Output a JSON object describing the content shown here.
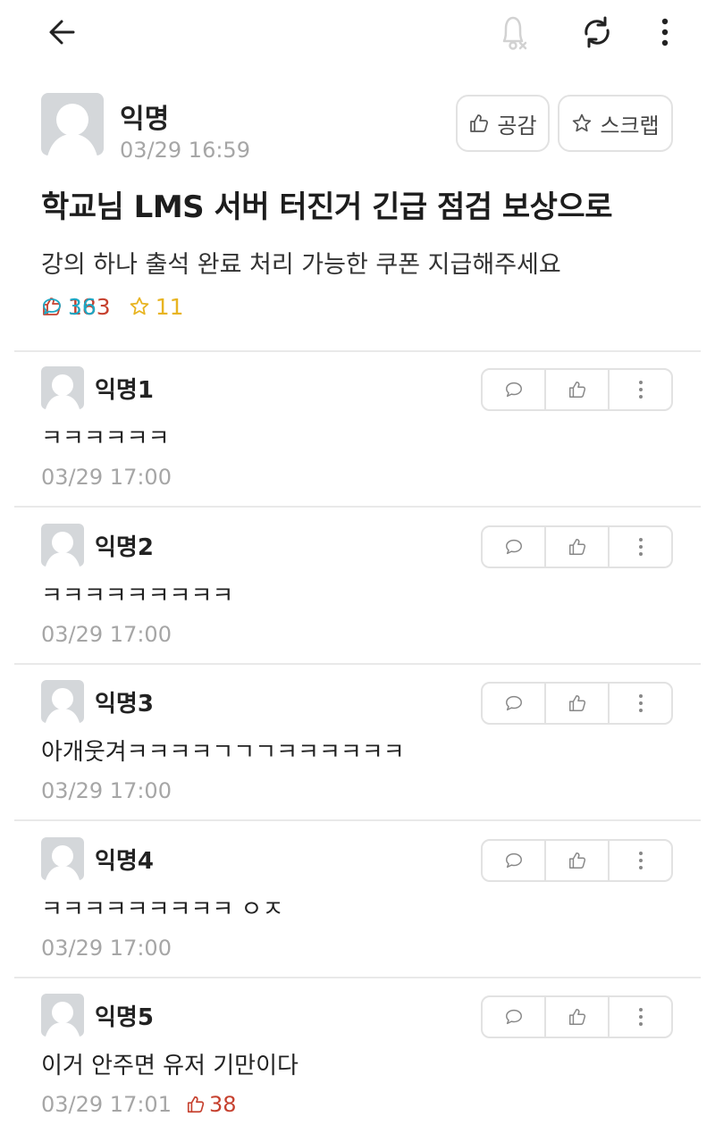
{
  "post": {
    "author": "익명",
    "time": "03/29 16:59",
    "like_label": "공감",
    "scrap_label": "스크랩",
    "title": "학교님 LMS 서버 터진거 긴급 점검 보상으로",
    "body": "강의 하나 출석 완료 처리 가능한 쿠폰 지급해주세요",
    "likes": "183",
    "comments": "36",
    "scraps": "11"
  },
  "comments": [
    {
      "author": "익명1",
      "text": "ㅋㅋㅋㅋㅋㅋ",
      "time": "03/29 17:00",
      "votes": ""
    },
    {
      "author": "익명2",
      "text": "ㅋㅋㅋㅋㅋㅋㅋㅋㅋ",
      "time": "03/29 17:00",
      "votes": ""
    },
    {
      "author": "익명3",
      "text": "아개웃겨ㅋㅋㅋㅋㄱㄱㄱㅋㅋㅋㅋㅋㅋ",
      "time": "03/29 17:00",
      "votes": ""
    },
    {
      "author": "익명4",
      "text": "ㅋㅋㅋㅋㅋㅋㅋㅋㅋ ㅇㅈ",
      "time": "03/29 17:00",
      "votes": ""
    },
    {
      "author": "익명5",
      "text": "이거 안주면 유저 기만이다",
      "time": "03/29 17:01",
      "votes": "38"
    }
  ],
  "colors": {
    "like": "#c6412f",
    "comment": "#1fa7c4",
    "scrap": "#e8b421",
    "muted": "#a6a6a6"
  },
  "icons": {
    "back": "arrow-left-icon",
    "bell": "bell-off-icon",
    "refresh": "refresh-icon",
    "more": "more-vertical-icon"
  }
}
